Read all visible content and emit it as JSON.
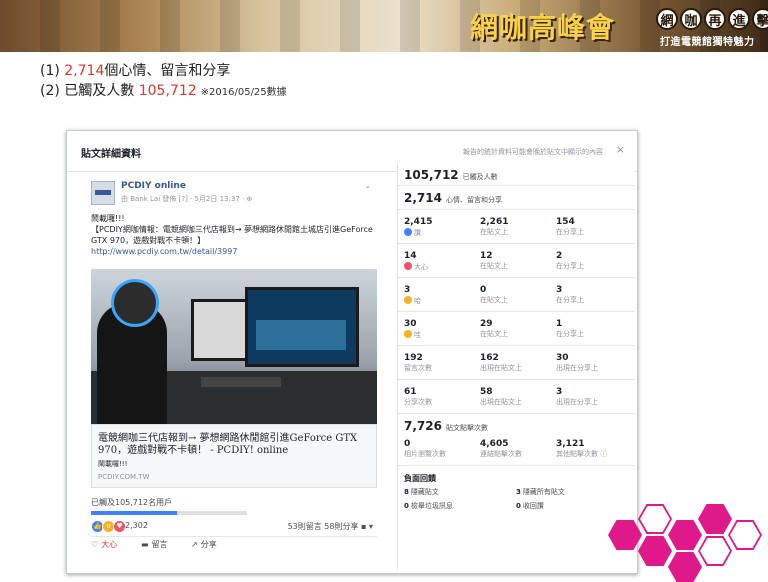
{
  "banner": {
    "title": "網咖高峰會",
    "seals": [
      "網",
      "咖",
      "再",
      "進",
      "擊"
    ],
    "subtitle": "打造電競館獨特魅力"
  },
  "summary": {
    "line1_prefix": "(1) ",
    "line1_number": "2,714",
    "line1_suffix": "個心情、留言和分享",
    "line2_prefix": "(2) 已觸及人數 ",
    "line2_number": "105,712",
    "line2_note": "※2016/05/25數據"
  },
  "dialog": {
    "title": "貼文詳細資料",
    "note": "報告的統計資料可能會晚於貼文中顯示的內容",
    "close": "×"
  },
  "post": {
    "page_name": "PCDIY online",
    "meta": "由 Bank Lai 發佈 [?] · 5月2日 13:37 · ⊕",
    "chevron": "⌄",
    "text_line1": "鬧載囉!!!",
    "text_line2": "【PCDIY網咖情報：電競網咖三代店報到→ 夢想網路休閒館土城店引進GeForce GTX 970，遊戲對戰不卡頓！】",
    "text_link": "http://www.pcdiy.com.tw/detail/3997",
    "link_title": "電競網咖三代店報到→ 夢想網路休閒館引進GeForce GTX 970，遊戲對戰不卡頓！ - PCDIY! online",
    "link_desc": "鬧載囉!!!",
    "link_domain": "PCDIY.COM.TW",
    "reached": "已觸及105,712名用戶",
    "reached_fraction": 0.55,
    "reaction_count": "2,302",
    "comments_shares": "53則留言  58則分享",
    "action_love": "大心",
    "action_comment": "留言",
    "action_share": "分享"
  },
  "stats": {
    "reach_number": "105,712",
    "reach_label": "已觸及人數",
    "engage_number": "2,714",
    "engage_label": "心情、留言和分享",
    "reactions": [
      {
        "emoji": "like",
        "a_num": "2,415",
        "a_lbl": "讚",
        "b_num": "2,261",
        "b_lbl": "在貼文上",
        "c_num": "154",
        "c_lbl": "在分享上"
      },
      {
        "emoji": "love",
        "a_num": "14",
        "a_lbl": "大心",
        "b_num": "12",
        "b_lbl": "在貼文上",
        "c_num": "2",
        "c_lbl": "在分享上"
      },
      {
        "emoji": "haha",
        "a_num": "3",
        "a_lbl": "哈",
        "b_num": "0",
        "b_lbl": "在貼文上",
        "c_num": "3",
        "c_lbl": "在分享上"
      },
      {
        "emoji": "wow",
        "a_num": "30",
        "a_lbl": "哇",
        "b_num": "29",
        "b_lbl": "在貼文上",
        "c_num": "1",
        "c_lbl": "在分享上"
      }
    ],
    "comments": {
      "a_num": "192",
      "a_lbl": "留言次數",
      "b_num": "162",
      "b_lbl": "出現在貼文上",
      "c_num": "30",
      "c_lbl": "出現在分享上"
    },
    "shares": {
      "a_num": "61",
      "a_lbl": "分享次數",
      "b_num": "58",
      "b_lbl": "出現在貼文上",
      "c_num": "3",
      "c_lbl": "出現在分享上"
    },
    "clicks_number": "7,726",
    "clicks_label": "貼文點擊次數",
    "clicks": {
      "a_num": "0",
      "a_lbl": "相片瀏覽次數",
      "b_num": "4,605",
      "b_lbl": "連結點擊次數",
      "c_num": "3,121",
      "c_lbl": "其他點擊次數 ⓘ"
    },
    "negative_title": "負面回饋",
    "negative": [
      {
        "num": "8",
        "label": "隱藏貼文"
      },
      {
        "num": "3",
        "label": "隱藏所有貼文"
      },
      {
        "num": "0",
        "label": "檢舉垃圾訊息"
      },
      {
        "num": "0",
        "label": "收回讚"
      }
    ]
  }
}
